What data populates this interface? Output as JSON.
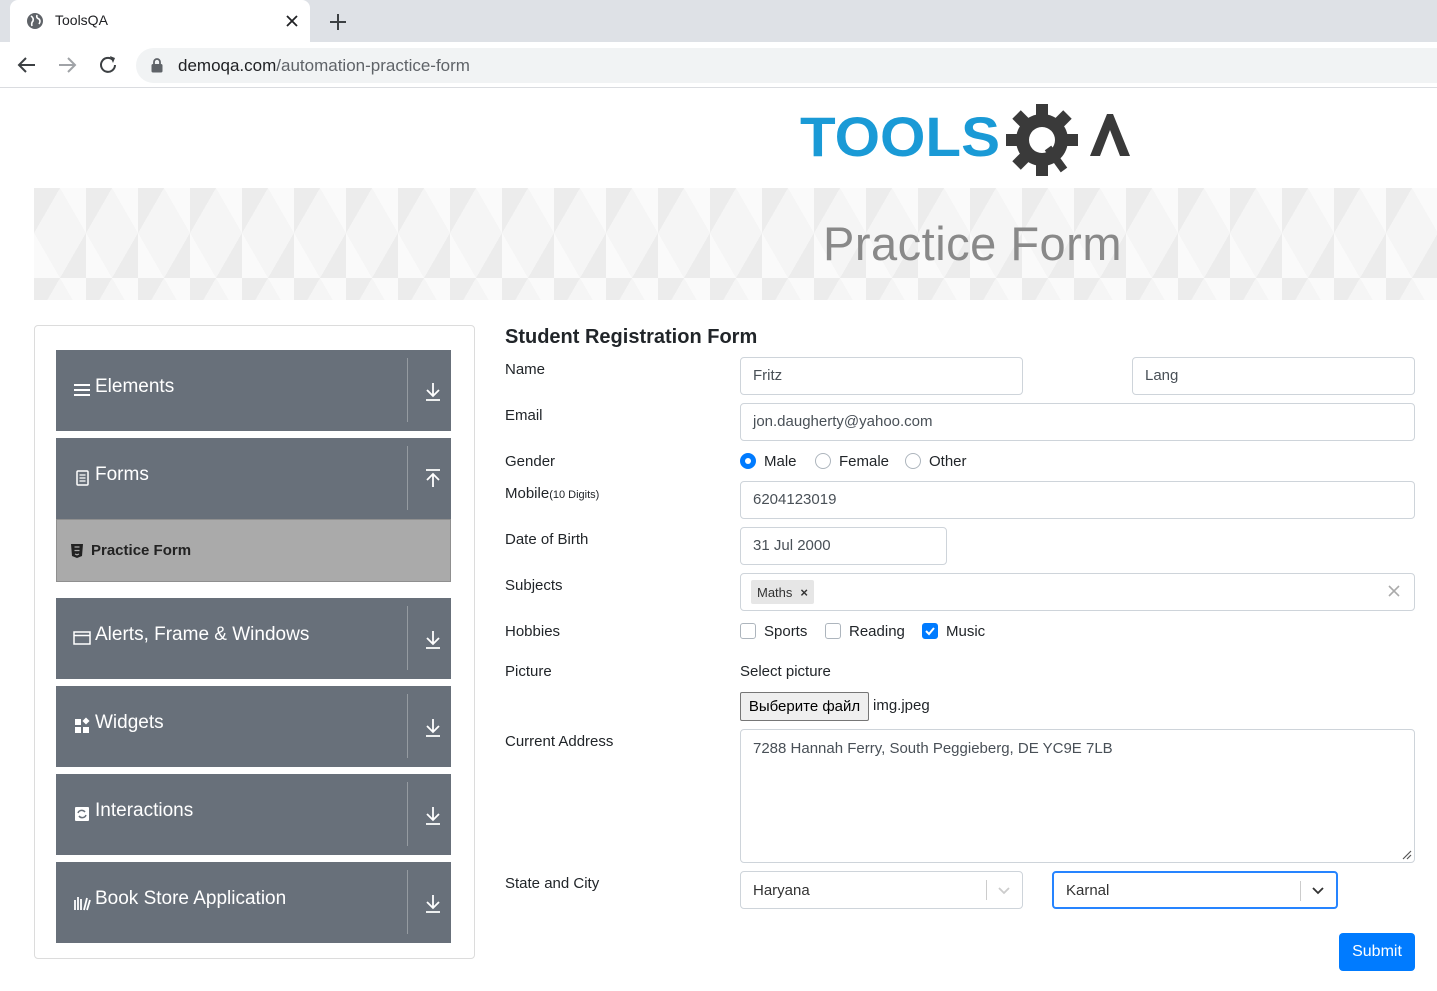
{
  "browser": {
    "tab_title": "ToolsQA",
    "url_host": "demoqa.com",
    "url_path": "/automation-practice-form"
  },
  "header": {
    "logo_text": "TOOLSQA",
    "banner_title": "Practice Form"
  },
  "sidebar": {
    "groups": [
      {
        "label": "Elements",
        "icon": "hamburger-icon",
        "expanded": false
      },
      {
        "label": "Forms",
        "icon": "document-icon",
        "expanded": true
      },
      {
        "label": "Alerts, Frame & Windows",
        "icon": "window-icon",
        "expanded": false
      },
      {
        "label": "Widgets",
        "icon": "widgets-icon",
        "expanded": false
      },
      {
        "label": "Interactions",
        "icon": "interactions-icon",
        "expanded": false
      },
      {
        "label": "Book Store Application",
        "icon": "books-icon",
        "expanded": false
      }
    ],
    "active_item": {
      "label": "Practice Form",
      "icon": "html5-icon"
    }
  },
  "form": {
    "title": "Student Registration Form",
    "labels": {
      "name": "Name",
      "email": "Email",
      "gender": "Gender",
      "mobile": "Mobile",
      "mobile_hint": "(10 Digits)",
      "dob": "Date of Birth",
      "subjects": "Subjects",
      "hobbies": "Hobbies",
      "picture": "Picture",
      "address": "Current Address",
      "state_city": "State and City"
    },
    "first_name": "Fritz",
    "last_name": "Lang",
    "email": "jon.daugherty@yahoo.com",
    "gender_options": [
      {
        "label": "Male",
        "checked": true
      },
      {
        "label": "Female",
        "checked": false
      },
      {
        "label": "Other",
        "checked": false
      }
    ],
    "mobile": "6204123019",
    "date_of_birth": "31 Jul 2000",
    "subjects": [
      "Maths"
    ],
    "hobbies": [
      {
        "label": "Sports",
        "checked": false
      },
      {
        "label": "Reading",
        "checked": false
      },
      {
        "label": "Music",
        "checked": true
      }
    ],
    "picture_prompt": "Select picture",
    "file_button": "Выберите файл",
    "file_name": "img.jpeg",
    "current_address": "7288 Hannah Ferry, South Peggieberg, DE YC9E 7LB",
    "state": "Haryana",
    "city": "Karnal",
    "submit_label": "Submit"
  },
  "colors": {
    "accent": "#007bff",
    "sidebar_bg": "#68707a",
    "active_item_bg": "#aaaaaa",
    "logo_blue": "#1a9ad6",
    "logo_dark": "#3a3a3a"
  }
}
